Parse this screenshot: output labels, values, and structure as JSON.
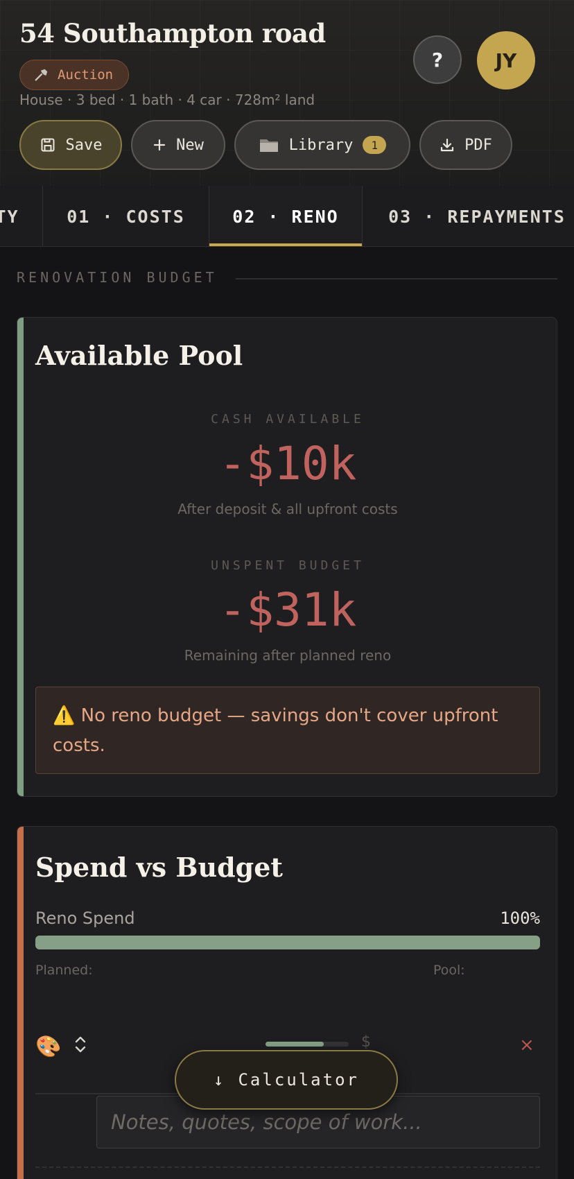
{
  "header": {
    "title": "54 Southampton road",
    "badge": {
      "icon": "hammer-icon",
      "label": "Auction"
    },
    "meta": "House · 3 bed · 1 bath · 4 car · 728m² land",
    "help_label": "?",
    "avatar_initials": "JY"
  },
  "toolbar": {
    "save_label": "Save",
    "new_label": "New",
    "library_label": "Library",
    "library_count": "1",
    "pdf_label": "PDF"
  },
  "tabs": [
    {
      "label": "TY",
      "active": false
    },
    {
      "label": "01 · COSTS",
      "active": false
    },
    {
      "label": "02 · RENO",
      "active": true
    },
    {
      "label": "03 · REPAYMENTS",
      "active": false
    }
  ],
  "section": {
    "label": "RENOVATION BUDGET"
  },
  "pool_card": {
    "title": "Available Pool",
    "cash_label": "CASH AVAILABLE",
    "cash_value": "-$10k",
    "cash_sub": "After deposit & all upfront costs",
    "unspent_label": "UNSPENT BUDGET",
    "unspent_value": "-$31k",
    "unspent_sub": "Remaining after planned reno",
    "warning": "⚠️ No reno budget — savings don't cover upfront costs."
  },
  "spend_card": {
    "title": "Spend vs Budget",
    "progress_label": "Reno Spend",
    "progress_pct": "100%",
    "progress_fraction": 1.0,
    "planned_label": "Planned:",
    "pool_label": "Pool:",
    "row": {
      "emoji": "🎨",
      "sort_glyph": "⌃⌄",
      "currency": "$",
      "remove": "×"
    },
    "notes_placeholder": "Notes, quotes, scope of work..."
  },
  "calculator": {
    "label": "Calculator",
    "arrow": "↓"
  },
  "colors": {
    "gold": "#c9a84f",
    "negative": "#c0625d",
    "pool_accent": "#7f9e84",
    "spend_accent": "#c5704a",
    "progress": "#86a088"
  }
}
